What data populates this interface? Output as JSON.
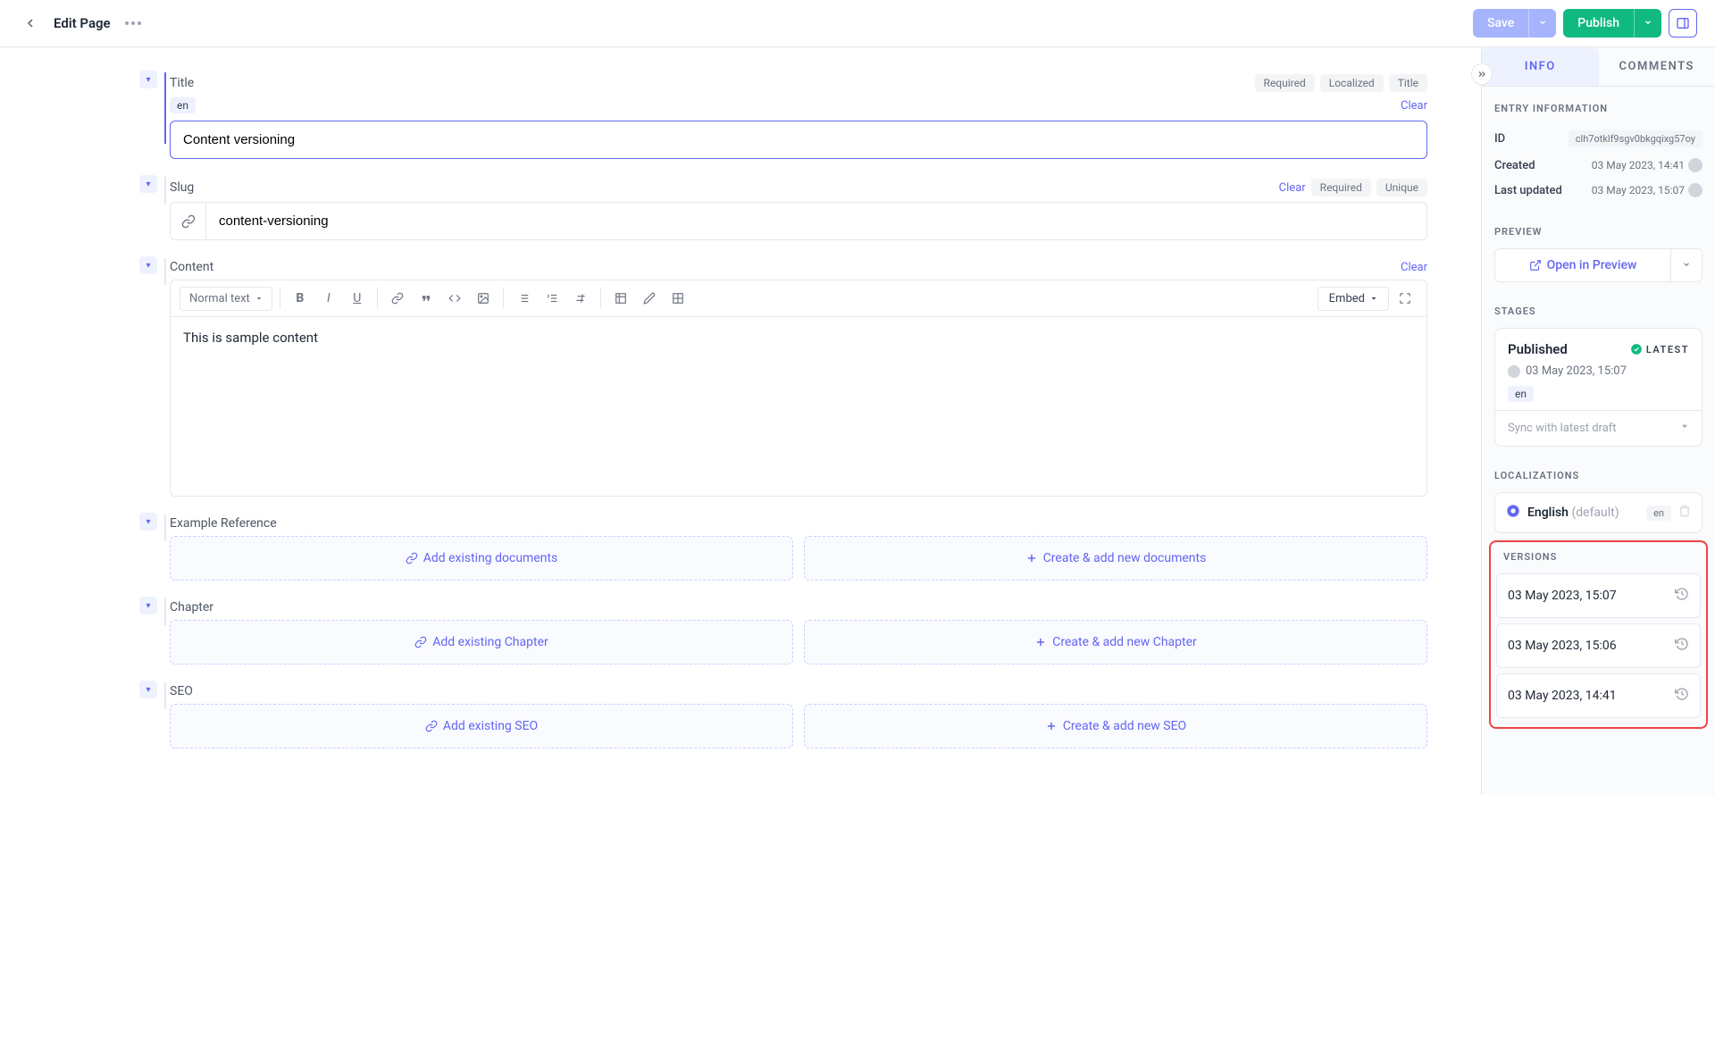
{
  "header": {
    "title": "Edit Page",
    "save_label": "Save",
    "publish_label": "Publish"
  },
  "fields": {
    "title": {
      "label": "Title",
      "locale": "en",
      "clear": "Clear",
      "badges": [
        "Required",
        "Localized",
        "Title"
      ],
      "value": "Content versioning"
    },
    "slug": {
      "label": "Slug",
      "clear": "Clear",
      "badges": [
        "Required",
        "Unique"
      ],
      "value": "content-versioning"
    },
    "content": {
      "label": "Content",
      "clear": "Clear",
      "format": "Normal text",
      "embed": "Embed",
      "body": "This is sample content"
    },
    "example_ref": {
      "label": "Example Reference",
      "add_existing": "Add existing documents",
      "create_new": "Create & add new documents"
    },
    "chapter": {
      "label": "Chapter",
      "add_existing": "Add existing Chapter",
      "create_new": "Create & add new Chapter"
    },
    "seo": {
      "label": "SEO",
      "add_existing": "Add existing SEO",
      "create_new": "Create & add new SEO"
    }
  },
  "sidebar": {
    "tabs": {
      "info": "INFO",
      "comments": "COMMENTS"
    },
    "entry_info": {
      "heading": "ENTRY INFORMATION",
      "id_label": "ID",
      "id_value": "clh7otklf9sgv0bkgqixg57oy",
      "created_label": "Created",
      "created_value": "03 May 2023, 14:41",
      "updated_label": "Last updated",
      "updated_value": "03 May 2023, 15:07"
    },
    "preview": {
      "heading": "PREVIEW",
      "button": "Open in Preview"
    },
    "stages": {
      "heading": "STAGES",
      "name": "Published",
      "latest": "LATEST",
      "date": "03 May 2023, 15:07",
      "locale": "en",
      "sync": "Sync with latest draft"
    },
    "localizations": {
      "heading": "LOCALIZATIONS",
      "name": "English",
      "default": "(default)",
      "code": "en"
    },
    "versions": {
      "heading": "VERSIONS",
      "items": [
        "03 May 2023, 15:07",
        "03 May 2023, 15:06",
        "03 May 2023, 14:41"
      ]
    }
  }
}
